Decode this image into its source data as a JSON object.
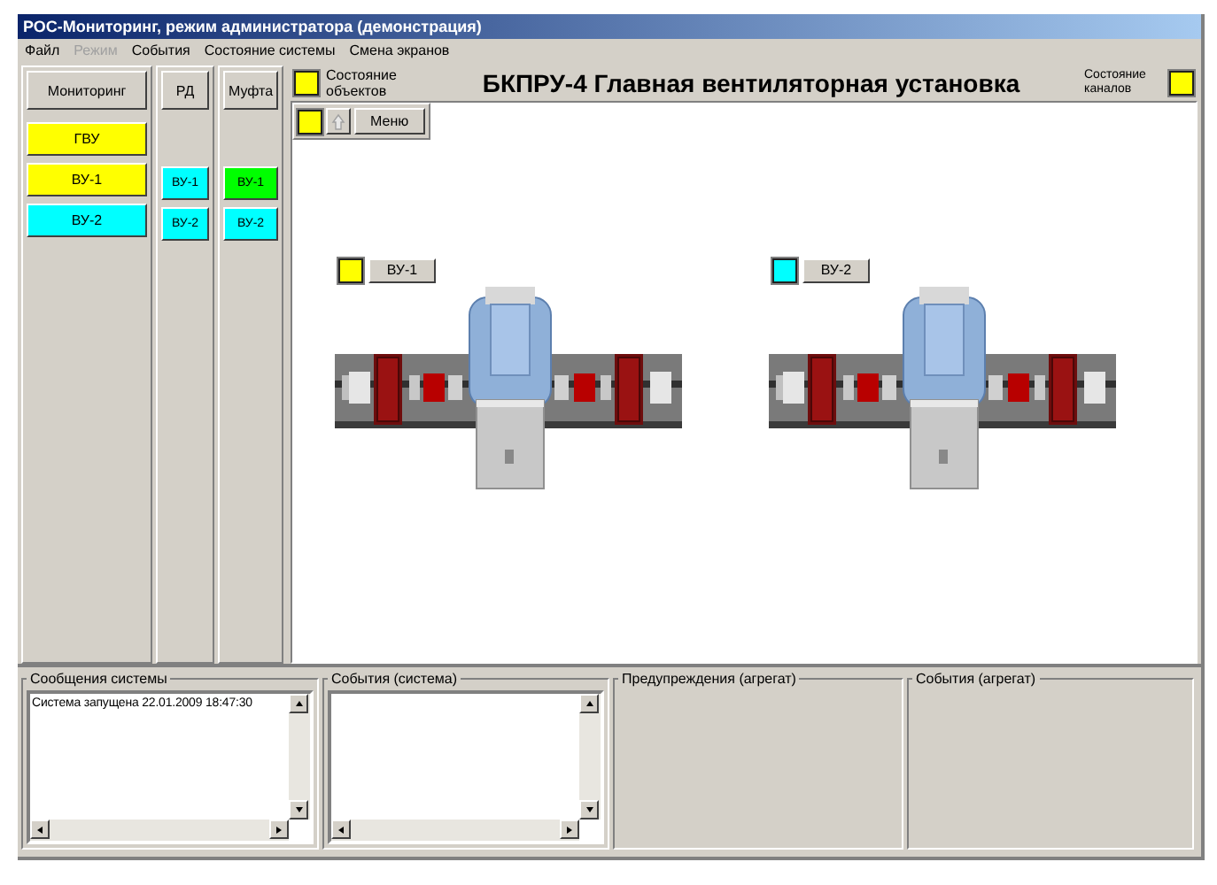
{
  "window": {
    "title": "РОС-Мониторинг, режим администратора (демонстрация)"
  },
  "menu": [
    {
      "label": "Файл",
      "disabled": false
    },
    {
      "label": "Режим",
      "disabled": true
    },
    {
      "label": "События",
      "disabled": false
    },
    {
      "label": "Состояние системы",
      "disabled": false
    },
    {
      "label": "Смена экранов",
      "disabled": false
    }
  ],
  "columns": [
    {
      "header": "Мониторинг",
      "items": [
        {
          "label": "ГВУ",
          "color": "#ffff00"
        },
        {
          "label": "ВУ-1",
          "color": "#ffff00"
        },
        {
          "label": "ВУ-2",
          "color": "#00ffff"
        }
      ]
    },
    {
      "header": "РД",
      "items": [
        {
          "label": "ВУ-1",
          "color": "#00ffff"
        },
        {
          "label": "ВУ-2",
          "color": "#00ffff"
        }
      ]
    },
    {
      "header": "Муфта",
      "items": [
        {
          "label": "ВУ-1",
          "color": "#00ff00"
        },
        {
          "label": "ВУ-2",
          "color": "#00ffff"
        }
      ]
    }
  ],
  "header": {
    "objects_status": {
      "label": "Состояние объектов",
      "color": "#ffff00"
    },
    "title": "БКПРУ-4 Главная вентиляторная установка",
    "channels_status": {
      "label": "Состояние каналов",
      "color": "#ffff00"
    }
  },
  "toolbar": {
    "color": "#ffff00",
    "up_disabled": true,
    "menu_button": "Меню"
  },
  "units": [
    {
      "label": "ВУ-1",
      "color": "#ffff00"
    },
    {
      "label": "ВУ-2",
      "color": "#00ffff"
    }
  ],
  "panels": [
    {
      "title": "Сообщения системы",
      "kind": "list",
      "lines": [
        "Система запущена 22.01.2009 18:47:30"
      ]
    },
    {
      "title": "События (система)",
      "kind": "list"
    },
    {
      "title": "Предупреждения (агрегат)",
      "kind": "group"
    },
    {
      "title": "События (агрегат)",
      "kind": "group"
    }
  ]
}
